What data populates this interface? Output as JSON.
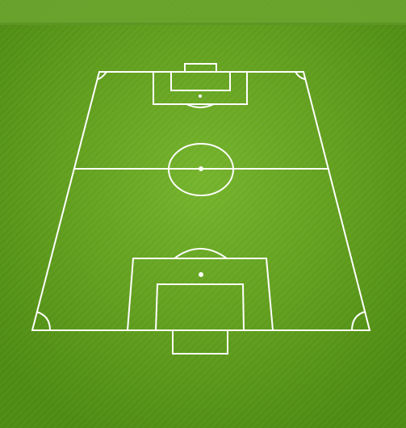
{
  "colors": {
    "grass_dark": "#4f8e14",
    "grass_mid": "#62a11e",
    "grass_light": "#73b22a",
    "header_bar": "#6ca42f",
    "line": "#ffffff"
  },
  "pitch": {
    "view": "perspective",
    "markings": [
      "touchline",
      "halfway-line",
      "center-circle",
      "center-spot",
      "penalty-area",
      "goal-area",
      "penalty-spot",
      "penalty-arc",
      "goal",
      "corner-arc"
    ]
  }
}
